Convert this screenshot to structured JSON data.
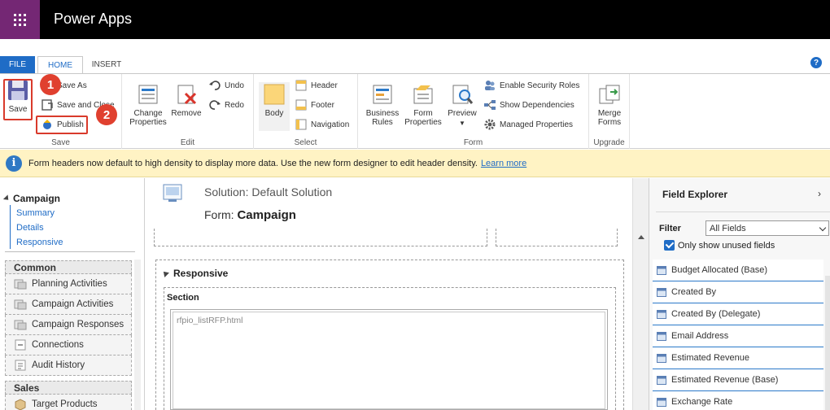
{
  "app": {
    "title": "Power Apps"
  },
  "tabs": {
    "file": "FILE",
    "home": "HOME",
    "insert": "INSERT"
  },
  "ribbon": {
    "save_group": {
      "save": "Save",
      "save_as": "Save As",
      "save_and_close": "Save and Close",
      "publish": "Publish",
      "label": "Save"
    },
    "edit_group": {
      "change_properties": "Change Properties",
      "remove": "Remove",
      "undo": "Undo",
      "redo": "Redo",
      "label": "Edit"
    },
    "select_group": {
      "body": "Body",
      "header": "Header",
      "footer": "Footer",
      "navigation": "Navigation",
      "label": "Select"
    },
    "form_group": {
      "business_rules": "Business Rules",
      "form_properties": "Form Properties",
      "preview": "Preview",
      "enable_security_roles": "Enable Security Roles",
      "show_dependencies": "Show Dependencies",
      "managed_properties": "Managed Properties",
      "label": "Form"
    },
    "upgrade_group": {
      "merge_forms": "Merge Forms",
      "label": "Upgrade"
    }
  },
  "callouts": {
    "one": "1",
    "two": "2"
  },
  "infobar": {
    "text": "Form headers now default to high density to display more data. Use the new form designer to edit header density.",
    "link": "Learn more"
  },
  "leftnav": {
    "entity": "Campaign",
    "forms": [
      "Summary",
      "Details",
      "Responsive"
    ],
    "common_label": "Common",
    "common_items": [
      "Planning Activities",
      "Campaign Activities",
      "Campaign Responses",
      "Connections",
      "Audit History"
    ],
    "sales_label": "Sales",
    "sales_items": [
      "Target Products"
    ]
  },
  "center": {
    "solution": "Solution: Default Solution",
    "form_prefix": "Form:",
    "form_name": "Campaign",
    "tab_title": "Responsive",
    "section_label": "Section",
    "web_resource": "rfpio_listRFP.html"
  },
  "field_explorer": {
    "title": "Field Explorer",
    "filter_label": "Filter",
    "filter_value": "All Fields",
    "only_unused_label": "Only show unused fields",
    "only_unused_checked": true,
    "fields": [
      "Budget Allocated (Base)",
      "Created By",
      "Created By (Delegate)",
      "Email Address",
      "Estimated Revenue",
      "Estimated Revenue (Base)",
      "Exchange Rate"
    ]
  },
  "colors": {
    "brand": "#742774",
    "accent": "#1f6cc6",
    "callout": "#e0402f",
    "info_bg": "#fff3c4"
  }
}
